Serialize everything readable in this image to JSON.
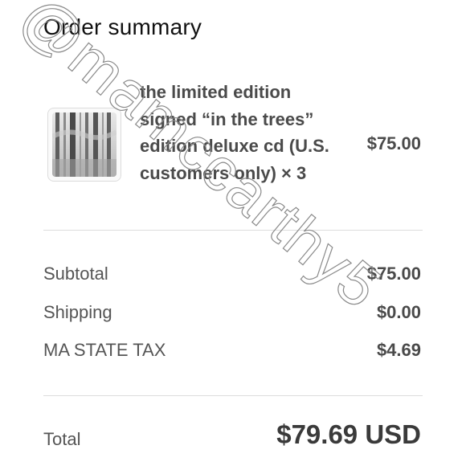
{
  "page": {
    "title": "Order summary"
  },
  "product": {
    "name": "the limited edition signed “in the trees” edition deluxe cd (U.S. customers only) × 3",
    "price": "$75.00",
    "thumbnail_icon": "album-cover-forest-image"
  },
  "summary": {
    "lines": [
      {
        "label": "Subtotal",
        "value": "$75.00"
      },
      {
        "label": "Shipping",
        "value": "$0.00"
      },
      {
        "label": "MA STATE TAX",
        "value": "$4.69"
      }
    ]
  },
  "total": {
    "label": "Total",
    "value": "$79.69 USD"
  },
  "watermark": {
    "text": "@mamccarthy5"
  },
  "colors": {
    "text": "#4a4a4a",
    "muted": "#555555",
    "divider": "#dddddd"
  }
}
